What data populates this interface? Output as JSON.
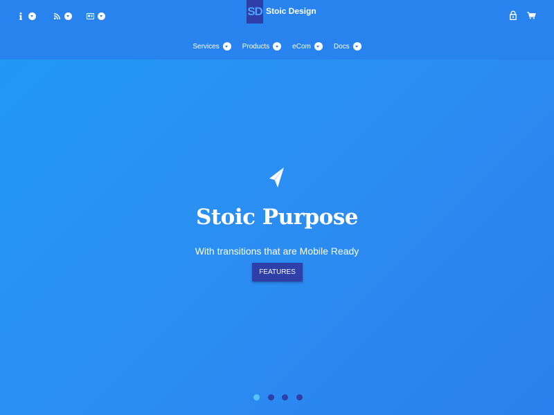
{
  "header": {
    "brand": {
      "logo_text": "SD",
      "name": "Stoic Design"
    },
    "utility_left": [
      {
        "icon": "info-icon"
      },
      {
        "icon": "rss-icon"
      },
      {
        "icon": "id-card-icon"
      }
    ],
    "utility_right": [
      {
        "icon": "lock-icon"
      },
      {
        "icon": "cart-icon"
      }
    ],
    "nav": [
      {
        "label": "Services"
      },
      {
        "label": "Products"
      },
      {
        "label": "eCom"
      },
      {
        "label": "Docs"
      }
    ]
  },
  "hero": {
    "icon": "paper-plane-icon",
    "title": "Stoic Purpose",
    "subtitle": "With transitions that are Mobile Ready",
    "button_label": "FEATURES",
    "slides_count": 4,
    "active_slide": 1
  },
  "colors": {
    "header_bg": "#2983ef",
    "hero_bg": "#2b8cf2",
    "accent": "#2f3fa8",
    "active_dot": "#55c4ff",
    "text": "#ffffff"
  }
}
